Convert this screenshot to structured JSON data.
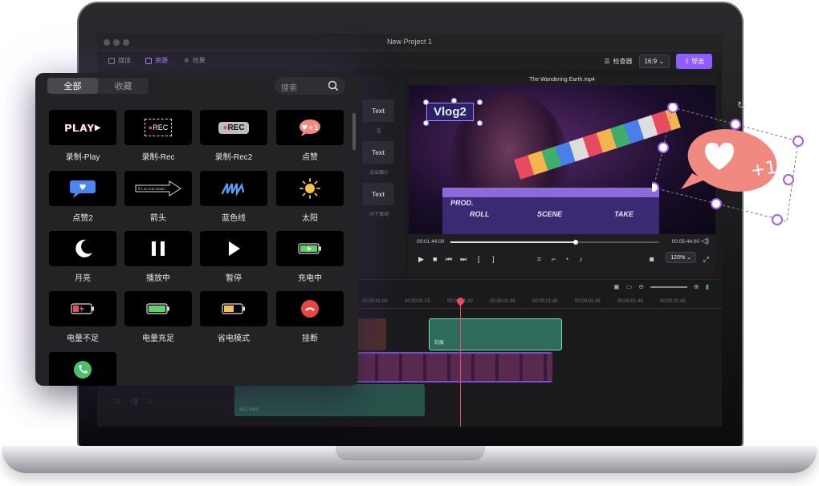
{
  "window": {
    "title": "New Project 1"
  },
  "toolbar": {
    "tabs": [
      {
        "label": "媒体",
        "icon": "media-icon"
      },
      {
        "label": "资源",
        "icon": "resource-icon"
      },
      {
        "label": "效果",
        "icon": "effect-icon"
      }
    ],
    "inspector_label": "检查器",
    "aspect_ratio": "16:9",
    "export_label": "导出"
  },
  "preview": {
    "title": "The Wandering Earth.mp4",
    "overlay_text": "Vlog2",
    "slate": {
      "prod": "PROD.",
      "roll": "ROLL",
      "scene": "SCENE",
      "take": "TAKE"
    },
    "current_time": "00:01:44:00",
    "total_time": "00:05:44:00",
    "progress": 0.6,
    "zoom": "120%"
  },
  "text_list": {
    "items": [
      {
        "label": "Text",
        "caption": "左"
      },
      {
        "label": "Text",
        "caption": "淡出缩小"
      },
      {
        "label": "Text",
        "caption": "向下滚动"
      }
    ]
  },
  "timeline": {
    "ticks": [
      "00:00:01:00",
      "00:00:01:15",
      "00:00:01:30",
      "00:00:01:45",
      "00:00:01:45",
      "00:00:01:45",
      "00:00:01:45",
      "00:00:01:45"
    ],
    "clip_label": "刮痕",
    "audio_label": "a91.mp3"
  },
  "panel": {
    "tabs": [
      {
        "label": "全部",
        "active": true
      },
      {
        "label": "收藏",
        "active": false
      }
    ],
    "search_placeholder": "搜索",
    "items": [
      {
        "label": "录制-Play",
        "icon": "play-text-icon"
      },
      {
        "label": "录制-Rec",
        "icon": "rec-frame-icon"
      },
      {
        "label": "录制-Rec2",
        "icon": "rec-badge-icon"
      },
      {
        "label": "点赞",
        "icon": "like-bubble-icon"
      },
      {
        "label": "点赞2",
        "icon": "heart-bubble-icon"
      },
      {
        "label": "箭头",
        "icon": "arrow-icon"
      },
      {
        "label": "蓝色线",
        "icon": "blue-scribble-icon"
      },
      {
        "label": "太阳",
        "icon": "sun-icon"
      },
      {
        "label": "月亮",
        "icon": "moon-icon"
      },
      {
        "label": "播放中",
        "icon": "pause-icon"
      },
      {
        "label": "暂停",
        "icon": "play-icon"
      },
      {
        "label": "充电中",
        "icon": "battery-charging-icon"
      },
      {
        "label": "电量不足",
        "icon": "battery-low-icon"
      },
      {
        "label": "电量充足",
        "icon": "battery-full-icon"
      },
      {
        "label": "省电模式",
        "icon": "battery-saver-icon"
      },
      {
        "label": "挂断",
        "icon": "hang-up-icon"
      },
      {
        "label": "",
        "icon": "answer-call-icon"
      }
    ],
    "thumb_text": {
      "play": "PLAY",
      "rec": "REC",
      "arrow_note": "It's an Icon book!"
    }
  },
  "sticker": {
    "text": "+1"
  },
  "colors": {
    "accent": "#8f5cff",
    "selection": "#a58cff",
    "playhead": "#e84a5f",
    "clip_green": "#6fe0b0"
  }
}
